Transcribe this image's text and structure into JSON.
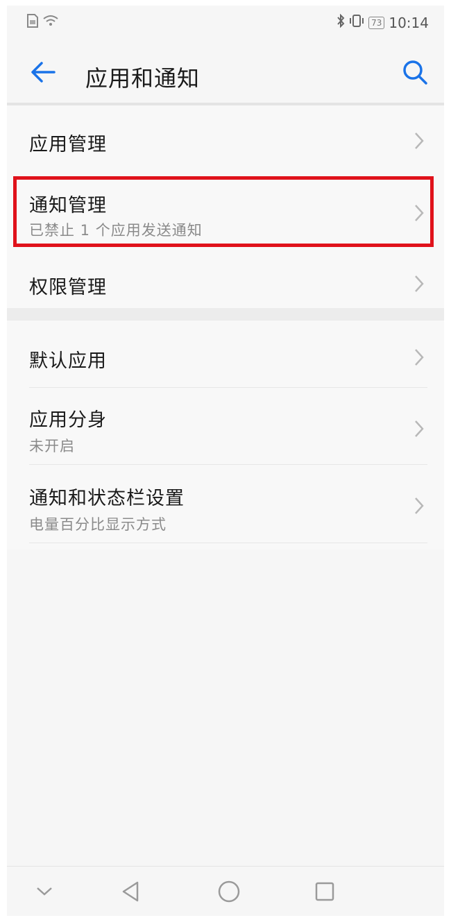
{
  "status_bar": {
    "left_icons": [
      "sim-icon",
      "wifi-icon"
    ],
    "right_icons": [
      "bluetooth-icon",
      "vibrate-icon"
    ],
    "battery": "73",
    "time": "10:14"
  },
  "app_bar": {
    "title": "应用和通知",
    "back_icon": "back-arrow-icon",
    "search_icon": "search-icon",
    "accent_color": "#1a73e8"
  },
  "groups": [
    {
      "items": [
        {
          "title": "应用管理",
          "subtitle": ""
        },
        {
          "title": "通知管理",
          "subtitle": "已禁止 1 个应用发送通知",
          "highlighted": true
        },
        {
          "title": "权限管理",
          "subtitle": ""
        }
      ]
    },
    {
      "items": [
        {
          "title": "默认应用",
          "subtitle": ""
        },
        {
          "title": "应用分身",
          "subtitle": "未开启"
        },
        {
          "title": "通知和状态栏设置",
          "subtitle": "电量百分比显示方式"
        }
      ]
    }
  ],
  "highlight_color": "#e0121b",
  "nav_bar": {
    "buttons": [
      "collapse-icon",
      "back-triangle-icon",
      "home-circle-icon",
      "recents-square-icon"
    ]
  }
}
